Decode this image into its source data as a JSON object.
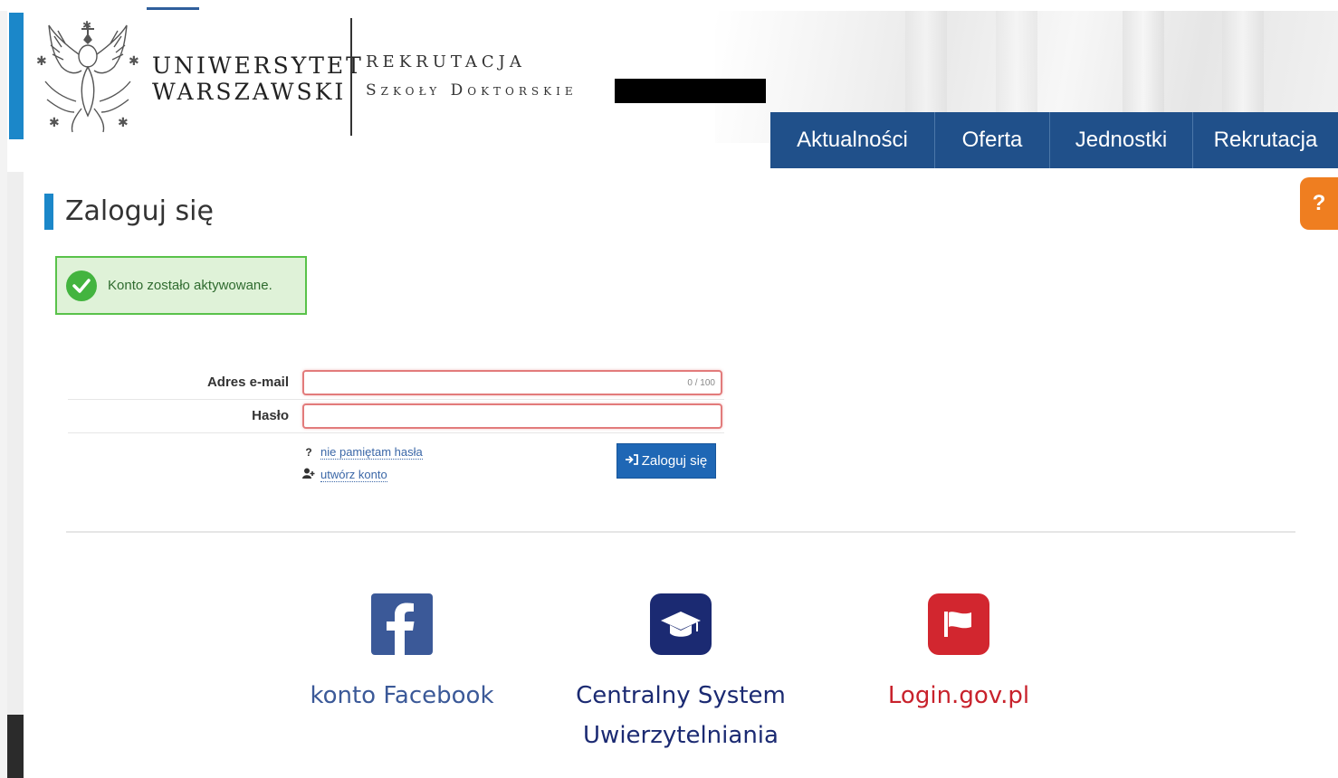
{
  "header": {
    "university_line1": "UNIWERSYTET",
    "university_line2": "WARSZAWSKI",
    "recruitment_title": "REKRUTACJA",
    "recruitment_subtitle": "Szkoły Doktorskie",
    "accent_color": "#1b87c9"
  },
  "nav": {
    "items": [
      {
        "label": "Aktualności"
      },
      {
        "label": "Oferta"
      },
      {
        "label": "Jednostki"
      },
      {
        "label": "Rekrutacja"
      }
    ],
    "background": "#20508a"
  },
  "help": {
    "label": "?"
  },
  "page": {
    "title": "Zaloguj się",
    "alert": {
      "message": "Konto zostało aktywowane.",
      "type": "success"
    }
  },
  "form": {
    "email_label": "Adres e-mail",
    "email_value": "",
    "email_counter": "0 / 100",
    "password_label": "Hasło",
    "password_value": "",
    "forgot_password": "nie pamiętam hasła",
    "forgot_icon": "?",
    "create_account": "utwórz konto",
    "login_button": "Zaloguj się"
  },
  "external_logins": [
    {
      "label": "konto Facebook",
      "icon": "facebook-icon",
      "color": "#3b5998"
    },
    {
      "label_line1": "Centralny System",
      "label_line2": "Uwierzytelniania",
      "icon": "graduation-cap-icon",
      "color": "#1b2a72"
    },
    {
      "label": "Login.gov.pl",
      "icon": "flag-icon",
      "color": "#c8222c"
    }
  ]
}
